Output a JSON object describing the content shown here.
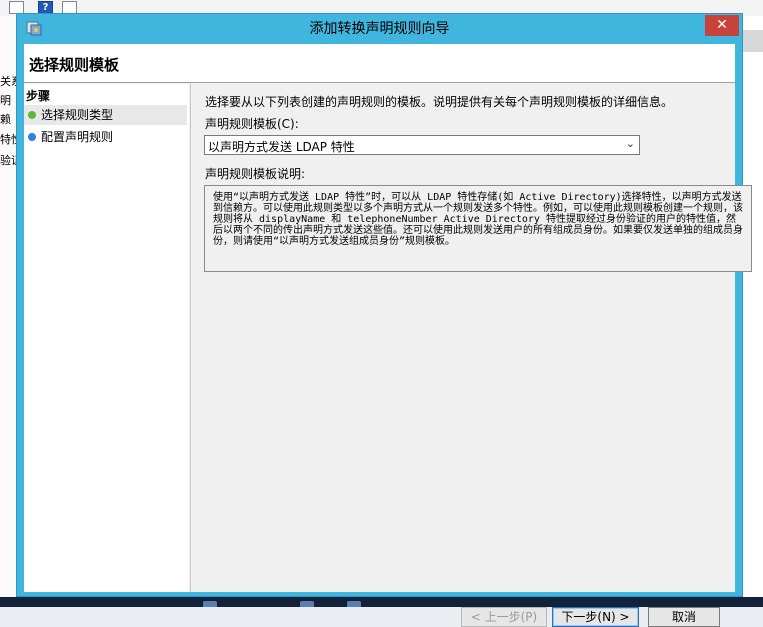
{
  "background": {
    "left_text": [
      "关系",
      "明",
      "赖",
      "特性",
      "验证"
    ]
  },
  "dialog": {
    "title": "添加转换声明规则向导",
    "close_glyph": "✕",
    "header_title": "选择规则模板",
    "steps_heading": "步骤",
    "steps": [
      {
        "label": "选择规则类型",
        "status": "current",
        "color": "#5bb832"
      },
      {
        "label": "配置声明规则",
        "status": "pending",
        "color": "#2f7ee0"
      }
    ],
    "intro_text": "选择要从以下列表创建的声明规则的模板。说明提供有关每个声明规则模板的详细信息。",
    "template_label": "声明规则模板(C):",
    "template_selected": "以声明方式发送 LDAP 特性",
    "description_label": "声明规则模板说明:",
    "description_text": "使用“以声明方式发送 LDAP 特性”时，可以从 LDAP 特性存储(如 Active Directory)选择特性，以声明方式发送到信赖方。可以使用此规则类型以多个声明方式从一个规则发送多个特性。例如，可以使用此规则模板创建一个规则，该规则将从 displayName 和 telephoneNumber Active Directory 特性提取经过身份验证的用户的特性值，然后以两个不同的传出声明方式发送这些值。还可以使用此规则发送用户的所有组成员身份。如果要仅发送单独的组成员身份，则请使用“以声明方式发送组成员身份”规则模板。",
    "buttons": {
      "prev": "< 上一步(P)",
      "next": "下一步(N) >",
      "cancel": "取消"
    }
  }
}
